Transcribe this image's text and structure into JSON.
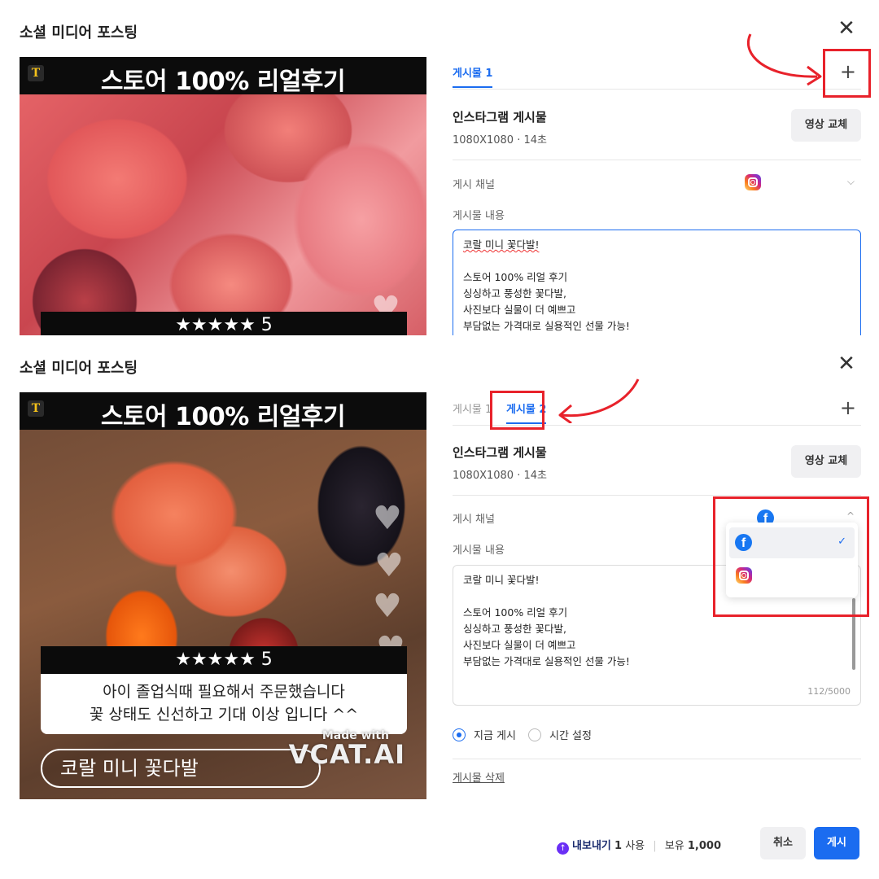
{
  "modal": {
    "title": "소셜 미디어 포스팅",
    "close_label": "✕"
  },
  "preview": {
    "banner_logo": "T",
    "banner_text": "스토어 100% 리얼후기",
    "stars": "★★★★★ 5",
    "review_line1": "아이 졸업식때 필요해서 주문했습니다",
    "review_line2": "꽃 상태도 신선하고 기대 이상 입니다 ^^",
    "product": "코랄 미니 꽃다발",
    "watermark_small": "Made with",
    "watermark_big": "VCAT.AI",
    "heart": "♥"
  },
  "tabs": {
    "tab1": "게시물 1",
    "tab2": "게시물 2",
    "add": "+"
  },
  "post": {
    "type": "인스타그램 게시물",
    "spec": "1080X1080 · 14초",
    "replace_label": "영상 교체",
    "channel_label": "게시 채널",
    "content_label": "게시물 내용",
    "content_lines": [
      "코랄 미니 꽃다발!",
      "",
      "스토어 100% 리얼 후기",
      "싱싱하고 풍성한 꽃다발,",
      "사진보다 실물이 더 예쁘고",
      "부담없는 가격대로 실용적인 선물 가능!"
    ],
    "char_count": "112/5000"
  },
  "icons": {
    "chevron_down": "⌵",
    "chevron_up": "^",
    "check": "✓",
    "facebook": "f"
  },
  "dropdown": {
    "options": [
      "facebook",
      "instagram"
    ],
    "selected": "facebook"
  },
  "schedule": {
    "now": "지금 게시",
    "later": "시간 설정",
    "selected": "now"
  },
  "delete_label": "게시물 삭제",
  "footer": {
    "export_label": "내보내기",
    "export_count": "1",
    "use_label": "사용",
    "balance_label": "보유",
    "balance_value": "1,000",
    "cancel_label": "취소",
    "post_label": "게시"
  },
  "colors": {
    "accent": "#1b6cf0",
    "highlight": "#e8222b",
    "facebook": "#1877f2"
  }
}
